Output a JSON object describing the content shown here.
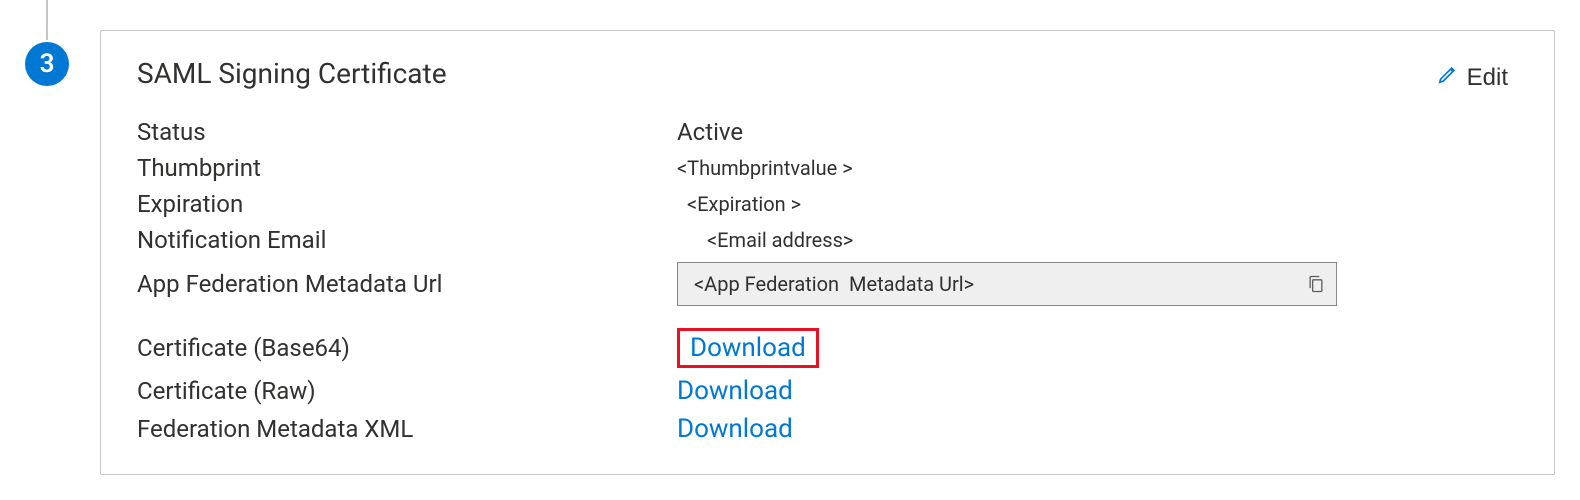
{
  "step": {
    "number": "3"
  },
  "card": {
    "title": "SAML Signing Certificate",
    "edit_label": "Edit"
  },
  "fields": {
    "status": {
      "label": "Status",
      "value": "Active"
    },
    "thumbprint": {
      "label": "Thumbprint",
      "value": "<Thumbprintvalue >"
    },
    "expiration": {
      "label": "Expiration",
      "value": "<Expiration >"
    },
    "notification_email": {
      "label": "Notification Email",
      "value": "<Email address>"
    },
    "metadata_url": {
      "label": "App Federation Metadata Url",
      "value": "<App Federation  Metadata Url>"
    },
    "cert_base64": {
      "label": "Certificate (Base64)",
      "link": "Download"
    },
    "cert_raw": {
      "label": "Certificate (Raw)",
      "link": "Download"
    },
    "fed_xml": {
      "label": "Federation Metadata XML",
      "link": "Download"
    }
  }
}
